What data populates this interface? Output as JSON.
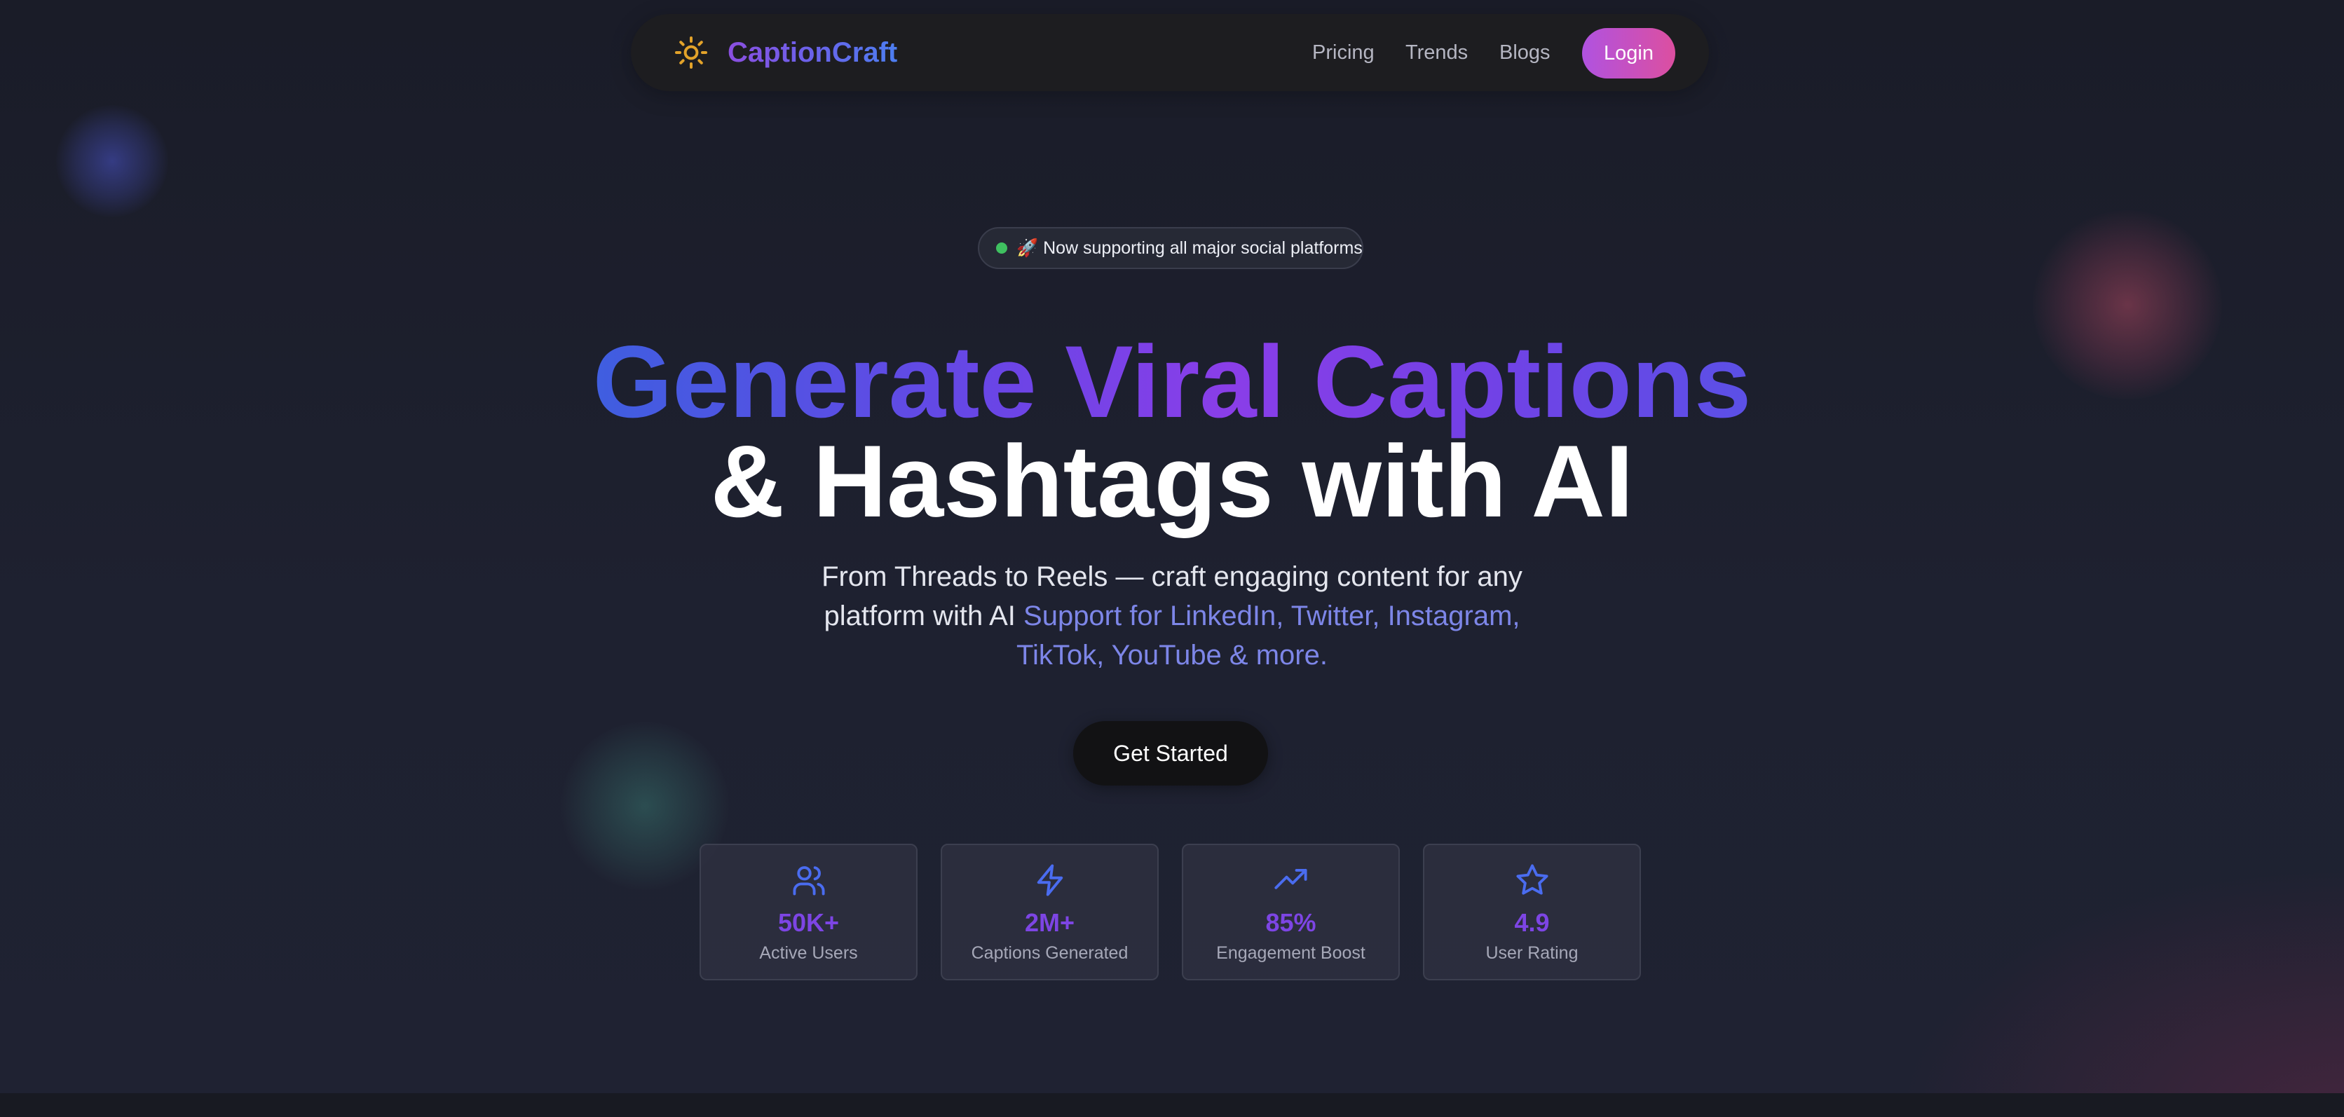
{
  "brand": {
    "name": "CaptionCraft",
    "logo_icon": "sun-icon",
    "logo_color": "#e3a32a"
  },
  "nav": {
    "links": [
      "Pricing",
      "Trends",
      "Blogs"
    ],
    "login_label": "Login"
  },
  "badge": {
    "text": "🚀 Now supporting all major social platforms",
    "dot_color": "#3fc060"
  },
  "hero": {
    "headline_gradient": "Generate Viral Captions",
    "headline_plain": "& Hashtags with AI",
    "subtitle_plain": "From Threads to Reels — craft engaging content for any platform with AI",
    "subtitle_accent": "Support for LinkedIn, Twitter, Instagram, TikTok, YouTube & more.",
    "cta_label": "Get Started"
  },
  "stats": [
    {
      "icon": "users-icon",
      "value": "50K+",
      "label": "Active Users"
    },
    {
      "icon": "lightning-icon",
      "value": "2M+",
      "label": "Captions Generated"
    },
    {
      "icon": "trending-up-icon",
      "value": "85%",
      "label": "Engagement Boost"
    },
    {
      "icon": "star-icon",
      "value": "4.9",
      "label": "User Rating"
    }
  ],
  "colors": {
    "accent_purple": "#7d45e4",
    "accent_blue": "#4a6cf0",
    "login_gradient_start": "#b052e0",
    "login_gradient_end": "#dc4fa0",
    "background": "#1c1f2b"
  }
}
